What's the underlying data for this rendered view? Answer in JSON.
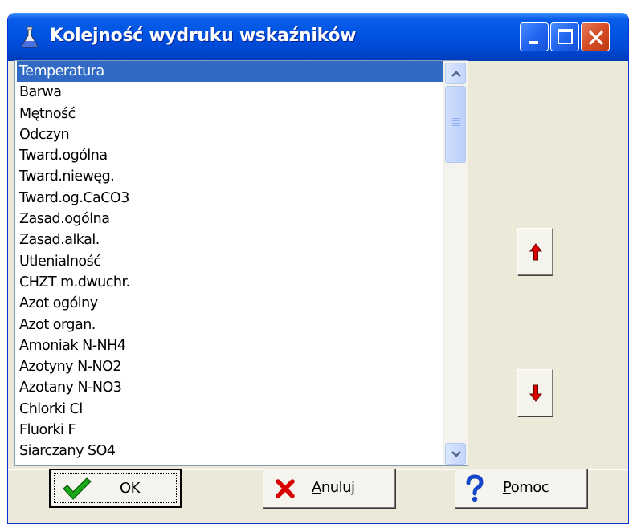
{
  "window": {
    "title": "Kolejność wydruku wskaźników"
  },
  "list": {
    "items": [
      "Temperatura",
      "Barwa",
      "Mętność",
      "Odczyn",
      "Tward.ogólna",
      "Tward.niewęg.",
      "Tward.og.CaCO3",
      "Zasad.ogólna",
      "Zasad.alkal.",
      "Utlenialność",
      "CHZT m.dwuchr.",
      "Azot ogólny",
      "Azot organ.",
      "Amoniak N-NH4",
      "Azotyny N-NO2",
      "Azotany N-NO3",
      "Chlorki Cl",
      "Fluorki F",
      "Siarczany SO4"
    ],
    "selected": "Temperatura"
  },
  "buttons": {
    "ok": {
      "first": "O",
      "rest": "K"
    },
    "cancel": {
      "first": "A",
      "rest": "nuluj"
    },
    "help": {
      "first": "P",
      "rest": "omoc"
    }
  },
  "icons": {
    "app": "flask-icon",
    "move_up": "red-arrow-up-icon",
    "move_down": "red-arrow-down-icon",
    "ok": "green-checkmark-icon",
    "cancel": "red-x-icon",
    "help": "question-mark-icon"
  },
  "colors": {
    "selection": "#316ac5",
    "titlebar": "#0055e5",
    "arrow": "#e00000"
  }
}
